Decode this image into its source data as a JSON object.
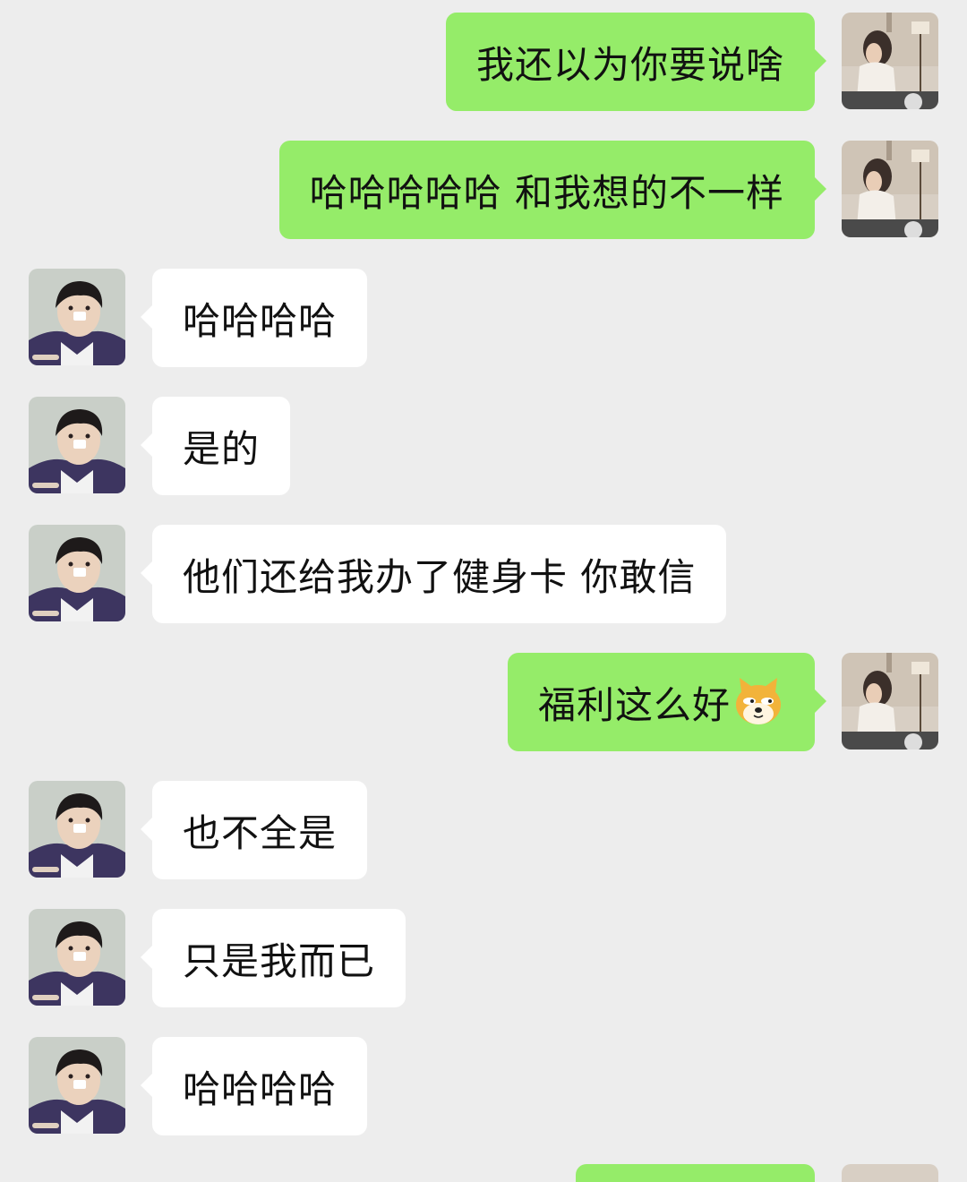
{
  "colors": {
    "background": "#ededed",
    "sent_bubble": "#95ec69",
    "received_bubble": "#ffffff",
    "text": "#111111"
  },
  "messages": [
    {
      "side": "right",
      "text": "我还以为你要说啥",
      "avatar": "user-avatar"
    },
    {
      "side": "right",
      "text": "哈哈哈哈哈 和我想的不一样",
      "avatar": "user-avatar"
    },
    {
      "side": "left",
      "text": "哈哈哈哈",
      "avatar": "contact-avatar"
    },
    {
      "side": "left",
      "text": "是的",
      "avatar": "contact-avatar"
    },
    {
      "side": "left",
      "text": "他们还给我办了健身卡 你敢信",
      "avatar": "contact-avatar"
    },
    {
      "side": "right",
      "text": "福利这么好",
      "emoji": "doge-emoji",
      "avatar": "user-avatar"
    },
    {
      "side": "left",
      "text": "也不全是",
      "avatar": "contact-avatar"
    },
    {
      "side": "left",
      "text": "只是我而已",
      "avatar": "contact-avatar"
    },
    {
      "side": "left",
      "text": "哈哈哈哈",
      "avatar": "contact-avatar"
    }
  ]
}
